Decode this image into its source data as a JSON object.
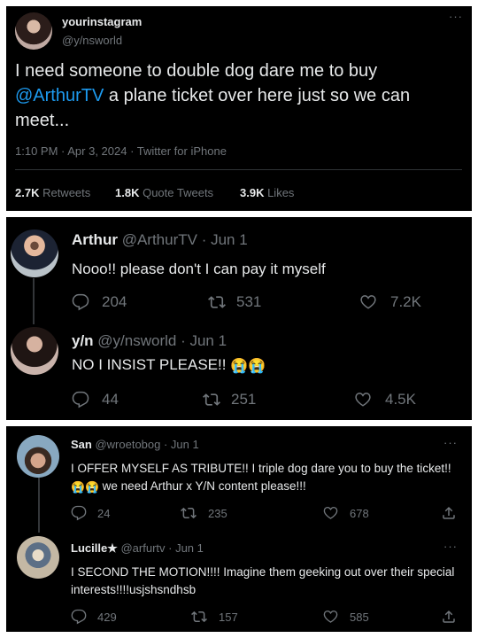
{
  "main_tweet": {
    "display_name": "yourinstagram",
    "handle": "@y/nsworld",
    "text_before": "I need someone to double dog dare me to buy ",
    "mention": "@ArthurTV",
    "text_after": " a plane ticket over here just so we can meet...",
    "timestamp": "1:10 PM · Apr 3, 2024 · Twitter for iPhone",
    "retweets_count": "2.7K",
    "retweets_label": " Retweets",
    "quotes_count": "1.8K",
    "quotes_label": " Quote Tweets",
    "likes_count": "3.9K",
    "likes_label": " Likes",
    "more": "···"
  },
  "thread1": {
    "reply1": {
      "name": "Arthur",
      "handle": "@ArthurTV",
      "date": " · Jun 1",
      "text": "Nooo!! please don't I can pay it myself",
      "replies": "204",
      "retweets": "531",
      "likes": "7.2K"
    },
    "reply2": {
      "name": "y/n",
      "handle": "@y/nsworld",
      "date": " · Jun 1",
      "text": "NO I INSIST PLEASE!! ",
      "emoji": "😭😭",
      "replies": "44",
      "retweets": "251",
      "likes": "4.5K"
    }
  },
  "thread2": {
    "reply1": {
      "name": "San",
      "handle": "@wroetobog",
      "date": " · Jun 1",
      "text_part1": "I OFFER MYSELF AS TRIBUTE!! I triple dog dare you to buy the ticket!! ",
      "emoji": "😭😭",
      "text_part2": " we need Arthur x Y/N content please!!!",
      "replies": "24",
      "retweets": "235",
      "likes": "678",
      "more": "···"
    },
    "reply2": {
      "name": "Lucille★",
      "handle": "@arfurtv",
      "date": " · Jun 1",
      "text": "I SECOND THE MOTION!!!! Imagine them geeking out over their special interests!!!!usjshsndhsb",
      "replies": "429",
      "retweets": "157",
      "likes": "585",
      "more": "···"
    }
  },
  "colors": {
    "background": "#000000",
    "text": "#e7e9ea",
    "secondary": "#71767b",
    "link": "#1d9bf0",
    "divider": "#2f3336"
  },
  "icons": [
    "reply-icon",
    "retweet-icon",
    "like-icon",
    "share-icon",
    "more-icon"
  ]
}
